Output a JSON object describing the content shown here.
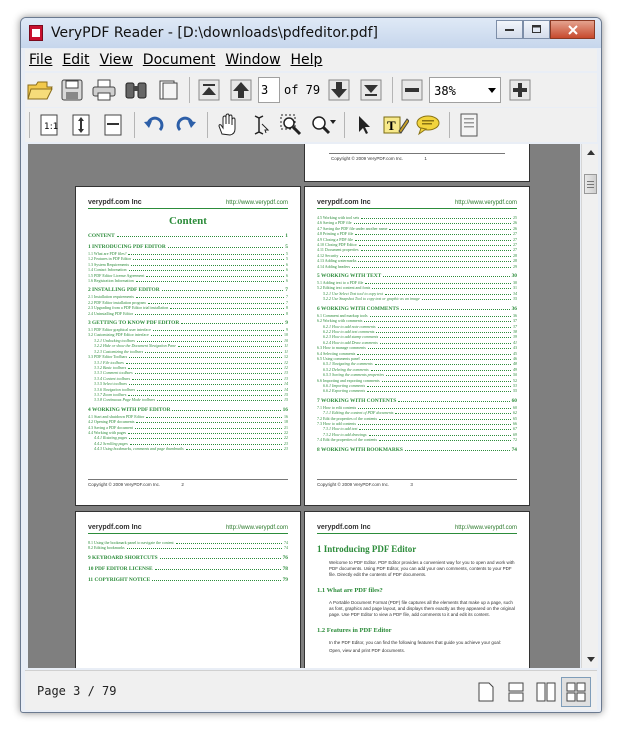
{
  "window": {
    "title": "VeryPDF Reader - [D:\\downloads\\pdfeditor.pdf]"
  },
  "menu": [
    {
      "label": "File"
    },
    {
      "label": "Edit"
    },
    {
      "label": "View"
    },
    {
      "label": "Document"
    },
    {
      "label": "Window"
    },
    {
      "label": "Help"
    }
  ],
  "toolbar": {
    "current_page": "3",
    "of_label": "of 79",
    "zoom": "38%"
  },
  "pages": {
    "top_partial_footer": "Copyright © 2009 VeryPDF.com Inc.",
    "top_partial_num": "1",
    "header_logo": "verypdf.com Inc",
    "header_url": "http://www.verypdf.com",
    "page2": {
      "title": "Content",
      "footer": "Copyright © 2009 VeryPDF.com Inc.",
      "num": "2",
      "toc": [
        {
          "t": "CONTENT",
          "p": "1",
          "k": "major"
        },
        {
          "t": "1 INTRODUCING PDF EDITOR",
          "p": "5",
          "k": "major"
        },
        {
          "t": "1.1 What are PDF files?",
          "p": "5",
          "k": ""
        },
        {
          "t": "1.2 Features in PDF Editor",
          "p": "5",
          "k": ""
        },
        {
          "t": "1.3 System Requirements",
          "p": "6",
          "k": ""
        },
        {
          "t": "1.4 Contact Information",
          "p": "6",
          "k": ""
        },
        {
          "t": "1.5 PDF Editor License Agreement",
          "p": "6",
          "k": ""
        },
        {
          "t": "1.6 Registration Information",
          "p": "6",
          "k": ""
        },
        {
          "t": "2 INSTALLING PDF EDITOR",
          "p": "7",
          "k": "major"
        },
        {
          "t": "2.1 Installation requirements",
          "p": "7",
          "k": ""
        },
        {
          "t": "2.2 PDF Editor installation program",
          "p": "7",
          "k": ""
        },
        {
          "t": "2.3 Upgrading from a PDF Editor trial installation",
          "p": "8",
          "k": ""
        },
        {
          "t": "2.4 Uninstalling PDF Editor",
          "p": "8",
          "k": ""
        },
        {
          "t": "3 GETTING TO KNOW PDF EDITOR",
          "p": "9",
          "k": "major"
        },
        {
          "t": "3.1 PDF Editor graphical user interface",
          "p": "9",
          "k": ""
        },
        {
          "t": "3.2 Customizing PDF Editor interface",
          "p": "10",
          "k": ""
        },
        {
          "t": "3.2.1 Undocking toolbars",
          "p": "10",
          "k": "sub"
        },
        {
          "t": "3.2.2 Hide or show the Document Navigation Pane",
          "p": "11",
          "k": "sub"
        },
        {
          "t": "3.2.3 Customizing the toolbars",
          "p": "11",
          "k": "sub"
        },
        {
          "t": "3.3 PDF Editor Toolbars",
          "p": "12",
          "k": ""
        },
        {
          "t": "3.3.1 File toolbars",
          "p": "12",
          "k": "sub"
        },
        {
          "t": "3.3.2 Basic toolbars",
          "p": "12",
          "k": "sub"
        },
        {
          "t": "3.3.3 Comment toolbars",
          "p": "13",
          "k": "sub"
        },
        {
          "t": "3.3.4 Content toolbars",
          "p": "13",
          "k": "sub"
        },
        {
          "t": "3.3.5 Select toolbars",
          "p": "14",
          "k": "sub"
        },
        {
          "t": "3.3.6 Navigation toolbars",
          "p": "14",
          "k": "sub"
        },
        {
          "t": "3.3.7 Zoom toolbars",
          "p": "15",
          "k": "sub"
        },
        {
          "t": "3.3.8 Continuous Page Mode toolbars",
          "p": "15",
          "k": "sub"
        },
        {
          "t": "4 WORKING WITH PDF EDITOR",
          "p": "16",
          "k": "major"
        },
        {
          "t": "4.1 Start and shutdown PDF Editor",
          "p": "16",
          "k": ""
        },
        {
          "t": "4.2 Opening PDF documents",
          "p": "18",
          "k": ""
        },
        {
          "t": "4.3 Saving a PDF document",
          "p": "21",
          "k": ""
        },
        {
          "t": "4.4 Working with pages",
          "p": "22",
          "k": ""
        },
        {
          "t": "4.4.1 Rotating pages",
          "p": "22",
          "k": "sub"
        },
        {
          "t": "4.4.2 Scrolling pages",
          "p": "23",
          "k": "sub"
        },
        {
          "t": "4.4.3 Using bookmarks, comments and page thumbnails",
          "p": "23",
          "k": "sub"
        }
      ]
    },
    "page3": {
      "footer": "Copyright © 2009 VeryPDF.com Inc.",
      "num": "3",
      "toc": [
        {
          "t": "4.5 Working with tool sets",
          "p": "25",
          "k": ""
        },
        {
          "t": "4.6 Saving a PDF file",
          "p": "26",
          "k": ""
        },
        {
          "t": "4.7 Saving the PDF file under another name",
          "p": "26",
          "k": ""
        },
        {
          "t": "4.8 Printing a PDF file",
          "p": "27",
          "k": ""
        },
        {
          "t": "4.9 Closing a PDF file",
          "p": "27",
          "k": ""
        },
        {
          "t": "4.10 Closing PDF Editor",
          "p": "27",
          "k": ""
        },
        {
          "t": "4.11 Document properties",
          "p": "27",
          "k": ""
        },
        {
          "t": "4.12 Security",
          "p": "28",
          "k": ""
        },
        {
          "t": "4.13 Adding watermarks",
          "p": "28",
          "k": ""
        },
        {
          "t": "4.14 Adding headers",
          "p": "29",
          "k": ""
        },
        {
          "t": "5 WORKING WITH TEXT",
          "p": "30",
          "k": "major"
        },
        {
          "t": "5.1 Adding text to a PDF file",
          "p": "30",
          "k": ""
        },
        {
          "t": "5.2 Editing text content and fonts",
          "p": "31",
          "k": ""
        },
        {
          "t": "5.2.1 Use Select Text tool to copy text",
          "p": "34",
          "k": "sub"
        },
        {
          "t": "5.2.2 Use Snapshot Tool to copy text or graphic as an image",
          "p": "35",
          "k": "sub"
        },
        {
          "t": "6 WORKING WITH COMMENTS",
          "p": "36",
          "k": "major"
        },
        {
          "t": "6.1 Comment and markup tools",
          "p": "36",
          "k": ""
        },
        {
          "t": "6.2 Working with comments",
          "p": "37",
          "k": ""
        },
        {
          "t": "6.2.1 How to add note comments",
          "p": "37",
          "k": "sub"
        },
        {
          "t": "6.2.2 How to add text comments",
          "p": "38",
          "k": "sub"
        },
        {
          "t": "6.2.3 How to add stamp comments",
          "p": "39",
          "k": "sub"
        },
        {
          "t": "6.2.4 How to add Draw comments",
          "p": "41",
          "k": "sub"
        },
        {
          "t": "6.3 How to manage comments",
          "p": "43",
          "k": ""
        },
        {
          "t": "6.4 Selecting comments",
          "p": "45",
          "k": ""
        },
        {
          "t": "6.5 Using comments panel",
          "p": "46",
          "k": ""
        },
        {
          "t": "6.5.1 Navigating the comments",
          "p": "48",
          "k": "sub"
        },
        {
          "t": "6.5.2 Deleting the comments",
          "p": "49",
          "k": "sub"
        },
        {
          "t": "6.5.3 Sorting the comments properties",
          "p": "50",
          "k": "sub"
        },
        {
          "t": "6.6 Importing and exporting comments",
          "p": "52",
          "k": ""
        },
        {
          "t": "6.6.1 Importing comments",
          "p": "53",
          "k": "sub"
        },
        {
          "t": "6.6.2 Exporting comments",
          "p": "55",
          "k": "sub"
        },
        {
          "t": "7 WORKING WITH CONTENTS",
          "p": "60",
          "k": "major"
        },
        {
          "t": "7.1 How to edit contents",
          "p": "60",
          "k": ""
        },
        {
          "t": "7.1.1 Editing the content of PDF documents",
          "p": "62",
          "k": "sub"
        },
        {
          "t": "7.2 Edit the properties of the contents",
          "p": "65",
          "k": ""
        },
        {
          "t": "7.3 How to add contents",
          "p": "66",
          "k": ""
        },
        {
          "t": "7.3.1 How to add text",
          "p": "67",
          "k": "sub"
        },
        {
          "t": "7.3.2 How to add drawings",
          "p": "69",
          "k": "sub"
        },
        {
          "t": "7.4 Edit the properties of the contents",
          "p": "72",
          "k": ""
        },
        {
          "t": "8 WORKING WITH BOOKMARKS",
          "p": "74",
          "k": "major"
        }
      ]
    },
    "page4": {
      "toc": [
        {
          "t": "8.1 Using the bookmark panel to navigate the content",
          "p": "74",
          "k": ""
        },
        {
          "t": "8.2 Editing bookmarks",
          "p": "74",
          "k": ""
        },
        {
          "t": "9 KEYBOARD SHORTCUTS",
          "p": "76",
          "k": "major"
        },
        {
          "t": "10 PDF EDITOR LICENSE",
          "p": "78",
          "k": "major"
        },
        {
          "t": "11 COPYRIGHT NOTICE",
          "p": "79",
          "k": "major"
        }
      ]
    },
    "page5": {
      "h1": "1 Introducing PDF Editor",
      "p1": "Welcome to PDF Editor. PDF Editor provides a convenient way for you to open and work with PDF documents. Using PDF Editor, you can add your own comments, contents to your PDF file. Directly edit the contents of PDF documents.",
      "h2a": "1.1 What are PDF files?",
      "p2": "A Portable Document Format (PDF) file captures all the elements that make up a page, such as font, graphics and page layout, and displays them exactly as they appeared on the original page. Use PDF Editor to view a PDF file, add comments to it and edit its content.",
      "h2b": "1.2 Features in PDF Editor",
      "p3": "In the PDF Editor, you can find the following features that guide you achieve your goal:",
      "p4": "Open, view and print PDF documents."
    }
  },
  "status": {
    "page_label": "Page 3 / 79"
  }
}
